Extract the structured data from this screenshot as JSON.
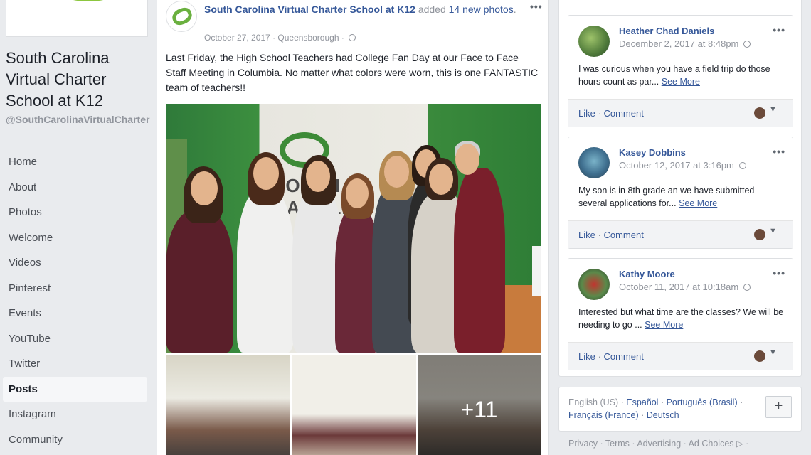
{
  "page": {
    "name": "South Carolina Virtual Charter School at K12",
    "handle": "@SouthCarolinaVirtualCharter"
  },
  "nav": [
    {
      "label": "Home"
    },
    {
      "label": "About"
    },
    {
      "label": "Photos"
    },
    {
      "label": "Welcome"
    },
    {
      "label": "Videos"
    },
    {
      "label": "Pinterest"
    },
    {
      "label": "Events"
    },
    {
      "label": "YouTube"
    },
    {
      "label": "Twitter"
    },
    {
      "label": "Posts",
      "active": true
    },
    {
      "label": "Instagram"
    },
    {
      "label": "Community"
    }
  ],
  "post": {
    "author": "South Carolina Virtual Charter School at K12",
    "action_text": "added",
    "photos_link": "14 new photos",
    "photos_suffix": ".",
    "date": "October 27, 2017",
    "separator": "·",
    "location": "Queensborough",
    "menu": "•••",
    "text": "Last Friday, the High School Teachers had College Fan Day at our Face to Face Staff Meeting in Columbia. No matter what colors were worn, this is one FANTASTIC team of teachers!!",
    "sign_text": "SOUTH CAROLI",
    "more_photos": "+11"
  },
  "reviews": [
    {
      "name": "Heather Chad Daniels",
      "date": "December 2, 2017 at 8:48pm",
      "text": "I was curious when you have a field trip do those hours count as par...",
      "see_more": "See More",
      "like": "Like",
      "comment": "Comment"
    },
    {
      "name": "Kasey Dobbins",
      "date": "October 12, 2017 at 3:16pm",
      "text": "My son is in 8th grade an we have submitted several applications for...",
      "see_more": "See More",
      "like": "Like",
      "comment": "Comment"
    },
    {
      "name": "Kathy Moore",
      "date": "October 11, 2017 at 10:18am",
      "text": "Interested but what time are the classes? We will be needing to go ...",
      "see_more": "See More",
      "like": "Like",
      "comment": "Comment"
    }
  ],
  "languages": {
    "current": "English (US)",
    "options": [
      "Español",
      "Português (Brasil)",
      "Français (France)",
      "Deutsch"
    ],
    "add": "+"
  },
  "footer": {
    "links": [
      "Privacy",
      "Terms",
      "Advertising",
      "Ad Choices"
    ]
  },
  "colors": {
    "link": "#365899",
    "background": "#e9ebee",
    "brand_green": "#8cc63f"
  }
}
